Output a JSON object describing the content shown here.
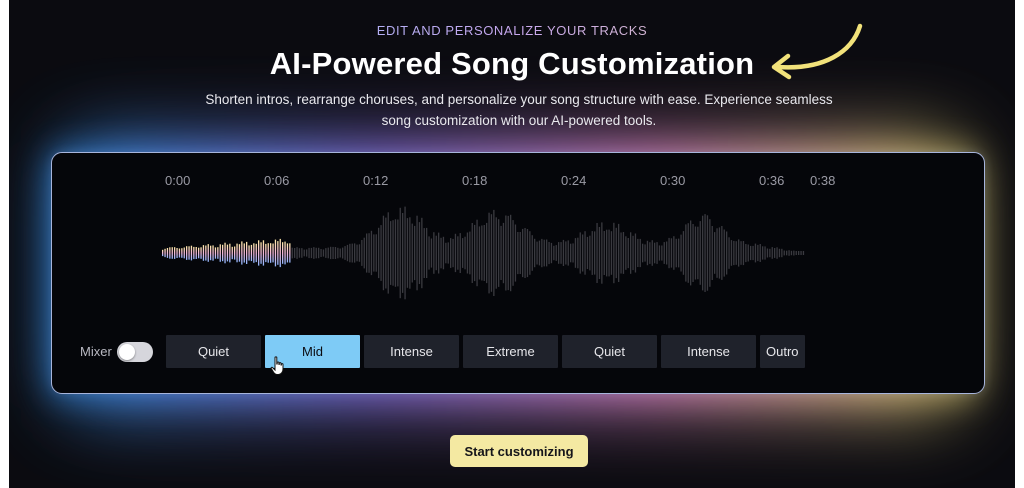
{
  "header": {
    "eyebrow": "EDIT AND PERSONALIZE YOUR TRACKS",
    "title": "AI-Powered Song Customization",
    "subtitle": "Shorten intros, rearrange choruses, and personalize your song structure with ease. Experience seamless song customization with our AI-powered tools."
  },
  "timeline": {
    "ticks": [
      "0:00",
      "0:06",
      "0:12",
      "0:18",
      "0:24",
      "0:30",
      "0:36",
      "0:38"
    ]
  },
  "playback": {
    "played_fraction": 0.2
  },
  "mixer": {
    "label": "Mixer",
    "enabled": false
  },
  "segments": [
    {
      "label": "Quiet",
      "active": false
    },
    {
      "label": "Mid",
      "active": true
    },
    {
      "label": "Intense",
      "active": false
    },
    {
      "label": "Extreme",
      "active": false
    },
    {
      "label": "Quiet",
      "active": false
    },
    {
      "label": "Intense",
      "active": false
    },
    {
      "label": "Outro",
      "active": false
    }
  ],
  "cta": {
    "label": "Start customizing"
  },
  "colors": {
    "background": "#0b0b10",
    "accent_blue": "#7ecbf6",
    "accent_yellow": "#f4e9a2",
    "arrow": "#f2e27a",
    "waveform_idle": "#3a3a40"
  },
  "icons": {
    "annotation": "curved-arrow-icon",
    "pointer": "hand-pointer-icon"
  }
}
